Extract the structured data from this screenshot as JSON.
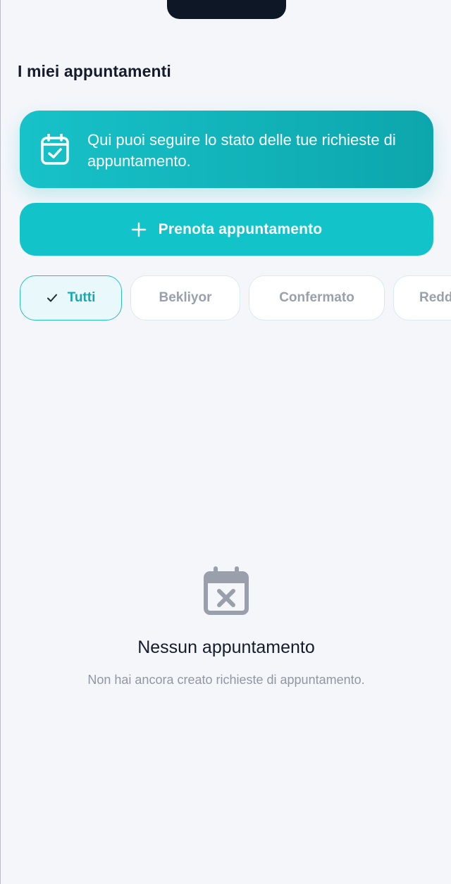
{
  "header": {
    "title": "I miei appuntamenti"
  },
  "banner": {
    "icon": "calendar-check-icon",
    "text": "Qui puoi seguire lo stato delle tue richieste di appuntamento."
  },
  "book_button": {
    "icon": "plus-icon",
    "label": "Prenota appuntamento"
  },
  "filters": {
    "selected": "Tutti",
    "chips": [
      {
        "label": "Tutti",
        "active": true
      },
      {
        "label": "Bekliyor",
        "active": false
      },
      {
        "label": "Confermato",
        "active": false
      },
      {
        "label": "Redd",
        "active": false
      }
    ]
  },
  "empty_state": {
    "icon": "calendar-x-icon",
    "title": "Nessun appuntamento",
    "subtitle": "Non hai ancora creato richieste di appuntamento."
  },
  "colors": {
    "accent": "#12c4ca",
    "background": "#f4f6fa",
    "text_primary": "#151b2b",
    "text_muted": "#9097a3"
  }
}
